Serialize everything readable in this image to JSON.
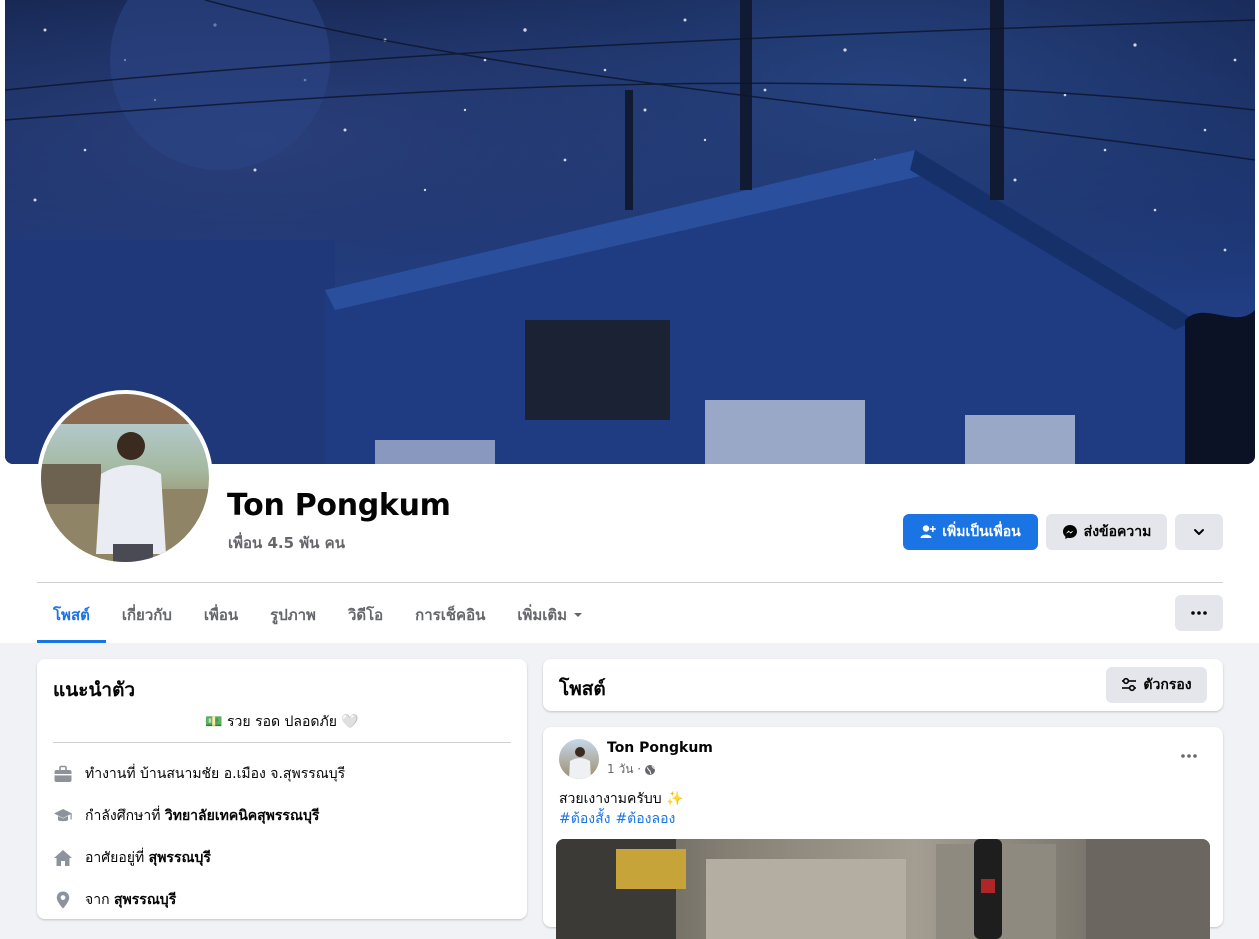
{
  "profile": {
    "name": "Ton Pongkum",
    "friends": "เพื่อน 4.5 พัน คน"
  },
  "actions": {
    "add_friend": "เพิ่มเป็นเพื่อน",
    "message": "ส่งข้อความ"
  },
  "tabs": [
    {
      "label": "โพสต์",
      "active": true
    },
    {
      "label": "เกี่ยวกับ"
    },
    {
      "label": "เพื่อน"
    },
    {
      "label": "รูปภาพ"
    },
    {
      "label": "วิดีโอ"
    },
    {
      "label": "การเช็คอิน"
    },
    {
      "label": "เพิ่มเติม"
    }
  ],
  "intro": {
    "title": "แนะนำตัว",
    "bio": "💵 รวย รอด ปลอดภัย 🤍",
    "items": [
      {
        "icon": "briefcase-icon",
        "prefix": "ทำงานที่ บ้านสนามชัย อ.เมือง จ.สุพรรณบุรี",
        "bold": ""
      },
      {
        "icon": "graduation-cap-icon",
        "prefix": "กำลังศึกษาที่ ",
        "bold": "วิทยาลัยเทคนิคสุพรรณบุรี"
      },
      {
        "icon": "home-icon",
        "prefix": "อาศัยอยู่ที่ ",
        "bold": "สุพรรณบุรี"
      },
      {
        "icon": "location-pin-icon",
        "prefix": "จาก ",
        "bold": "สุพรรณบุรี"
      }
    ]
  },
  "posts_header": {
    "title": "โพสต์",
    "filter": "ตัวกรอง"
  },
  "post": {
    "author": "Ton Pongkum",
    "time": "1 วัน ·",
    "text": "สวยเงางามครับบ ✨",
    "tags": [
      "#ต้องสั้ง",
      "#ต้องลอง"
    ]
  },
  "colors": {
    "accent": "#1b74e4",
    "secondary_button": "#e4e6eb",
    "background": "#f0f2f5"
  }
}
